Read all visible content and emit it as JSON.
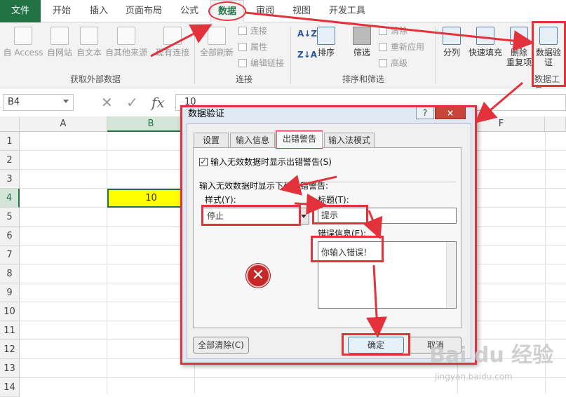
{
  "tabs": [
    "文件",
    "开始",
    "插入",
    "页面布局",
    "公式",
    "数据",
    "审阅",
    "视图",
    "开发工具"
  ],
  "ribbon": {
    "external": [
      "自 Access",
      "自网站",
      "自文本",
      "自其他来源",
      "现有连接"
    ],
    "group_external": "获取外部数据",
    "refresh": "全部刷新",
    "conn_items": [
      "连接",
      "属性",
      "编辑链接"
    ],
    "group_conn": "连接",
    "sort": "排序",
    "filter": "筛选",
    "filter_items": [
      "清除",
      "重新应用",
      "高级"
    ],
    "group_sort": "排序和筛选",
    "split": "分列",
    "flashfill": "快速填充",
    "dedup": [
      "删除",
      "重复项"
    ],
    "validate": [
      "数据验",
      "证"
    ],
    "group_tools": "数据工具"
  },
  "formula": {
    "namebox": "B4",
    "fx": "fx",
    "value": "10"
  },
  "grid": {
    "columns": [
      "A",
      "B",
      "F"
    ],
    "rows": [
      "1",
      "2",
      "3",
      "4",
      "5",
      "6",
      "7",
      "8",
      "9",
      "10",
      "11",
      "12",
      "13",
      "14"
    ],
    "b4": "10"
  },
  "dialog": {
    "title": "数据验证",
    "help": "?",
    "close": "×",
    "tabs": [
      "设置",
      "输入信息",
      "出错警告",
      "输入法模式"
    ],
    "show_error_label": "输入无效数据时显示出错警告(S)",
    "show_error_checked": "✓",
    "section_label": "输入无效数据时显示下列出错警告:",
    "style_label": "样式(Y):",
    "style_value": "停止",
    "title_label": "标题(T):",
    "title_value": "提示",
    "error_label": "错误信息(E):",
    "error_value": "你输入错误！",
    "stop_symbol": "✕",
    "clear_all": "全部清除(C)",
    "ok": "确定",
    "cancel": "取消"
  },
  "watermark": {
    "text": "Bai du 经验",
    "url": "jingyan.baidu.com"
  }
}
